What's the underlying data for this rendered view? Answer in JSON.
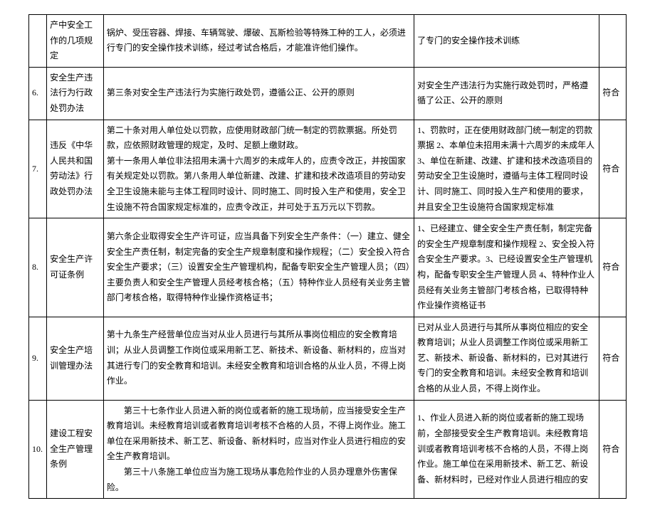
{
  "rows": [
    {
      "num": "",
      "name": "产中安全工作的几项规定",
      "main": "锅炉、受压容器、焊接、车辆驾驶、爆破、瓦斯检验等特殊工种的工人，必须进行专门的安全操作技术训练，经过考试合格后，才能准许他们操作。",
      "eval": "了专门的安全操作技术训练",
      "result": ""
    },
    {
      "num": "6.",
      "name": "安全生产违法行为行政处罚办法",
      "main": "第三条对安全生产违法行为实施行政处罚，遵循公正、公开的原则",
      "eval": "对安全生产违法行为实施行政处罚时，严格遵循了公正、公开的原则",
      "result": "符合"
    },
    {
      "num": "7.",
      "name": "违反《中华人民共和国劳动法》行政处罚办法",
      "main": "第二十条对用人单位处以罚款，应使用财政部门统一制定的罚款票据。所处罚款，应依照财政管理的规定，及时、足额上缴财政。　　　　　　　　　　　　　　　　　　　　　　　　　　　　　　　　　　　　第十一条用人单位非法招用未满十六周岁的未成年人的，应责令改正，并按国家有关规定处以罚款。第八条用人单位新建、改建、扩建和技术改造项目的劳动安全卫生设施未能与主体工程同时设计、同时施工、同时投入生产和使用，安全卫生设施不符合国家规定标准的，应责令改正，并可处于五万元以下罚款。",
      "eval": "1、罚款时，正在使用财政部门统一制定的罚款票据 2、本单位未招用未满十六周岁的未成年人 3、单位在新建、改建、扩建和技术改造项目的劳动安全卫生设施时，遵循与主体工程同时设计、同时施工、同时投入生产和使用的要求，并且安全卫生设施符合国家规定标准",
      "result": "符合"
    },
    {
      "num": "8.",
      "name": "安全生产许可证条例",
      "main": "第六条企业取得安全生产许可证，应当具备下列安全生产条件：（一）建立、健全安全生产责任制，制定完备的安全生产规章制度和操作规程；（二）安全投入符合安全生产要求；（三）设置安全生产管理机构，配备专职安全生产管理人员；（四）主要负责人和安全生产管理人员经考核合格；（五）特种作业人员经有关业务主管部门考核合格，取得特种作业操作资格证书；",
      "eval": "1、已经建立、健全安全生产责任制，制定完备的安全生产规章制度和操作规程 2、安全投入符合安全生产要求。3、已经设置安全生产管理机构，配备专职安全生产管理人员 4、特种作业人员经有关业务主管部门考核合格，已取得特种作业操作资格证书",
      "result": "符合"
    },
    {
      "num": "9.",
      "name": "安全生产培训管理办法",
      "main": "第十九条生产经营单位应当对从业人员进行与其所从事岗位相应的安全教育培训；从业人员调整工作岗位或采用新工艺、新技术、新设备、新材料的，应当对其进行专门的安全教育和培训。未经安全教育和培训合格的从业人员，不得上岗作业。",
      "eval": "已对从业人员进行与其所从事岗位相应的安全教育培训；从业人员调整工作岗位或采用新工艺、新技术、新设备、新材料的，已对其进行专门的安全教育和培训。未经安全教育和培训合格的从业人员，不得上岗作业。",
      "result": "符合"
    },
    {
      "num": "10.",
      "name": "建设工程安全生产管理条例",
      "main_lines": [
        "　　第三十七条作业人员进入新的岗位或者新的施工现场前，应当接受安全生产教育培训。未经教育培训或者教育培训考核不合格的人员，不得上岗作业。施工单位在采用新技术、新工艺、新设备、新材料时，应当对作业人员进行相应的安全生产教育培训。",
        "　　第三十八条施工单位应当为施工现场从事危险作业的人员办理意外伤害保险。"
      ],
      "eval": "1、作业人员进入新的岗位或者新的施工现场前，全部接受安全生产教育培训。未经教育培训或者教育培训考核不合格的人员，不得上岗作业。施工单位在采用新技术、新工艺、新设备、新材料时，已经对作业人员进行相应的安",
      "result": "符合"
    }
  ]
}
